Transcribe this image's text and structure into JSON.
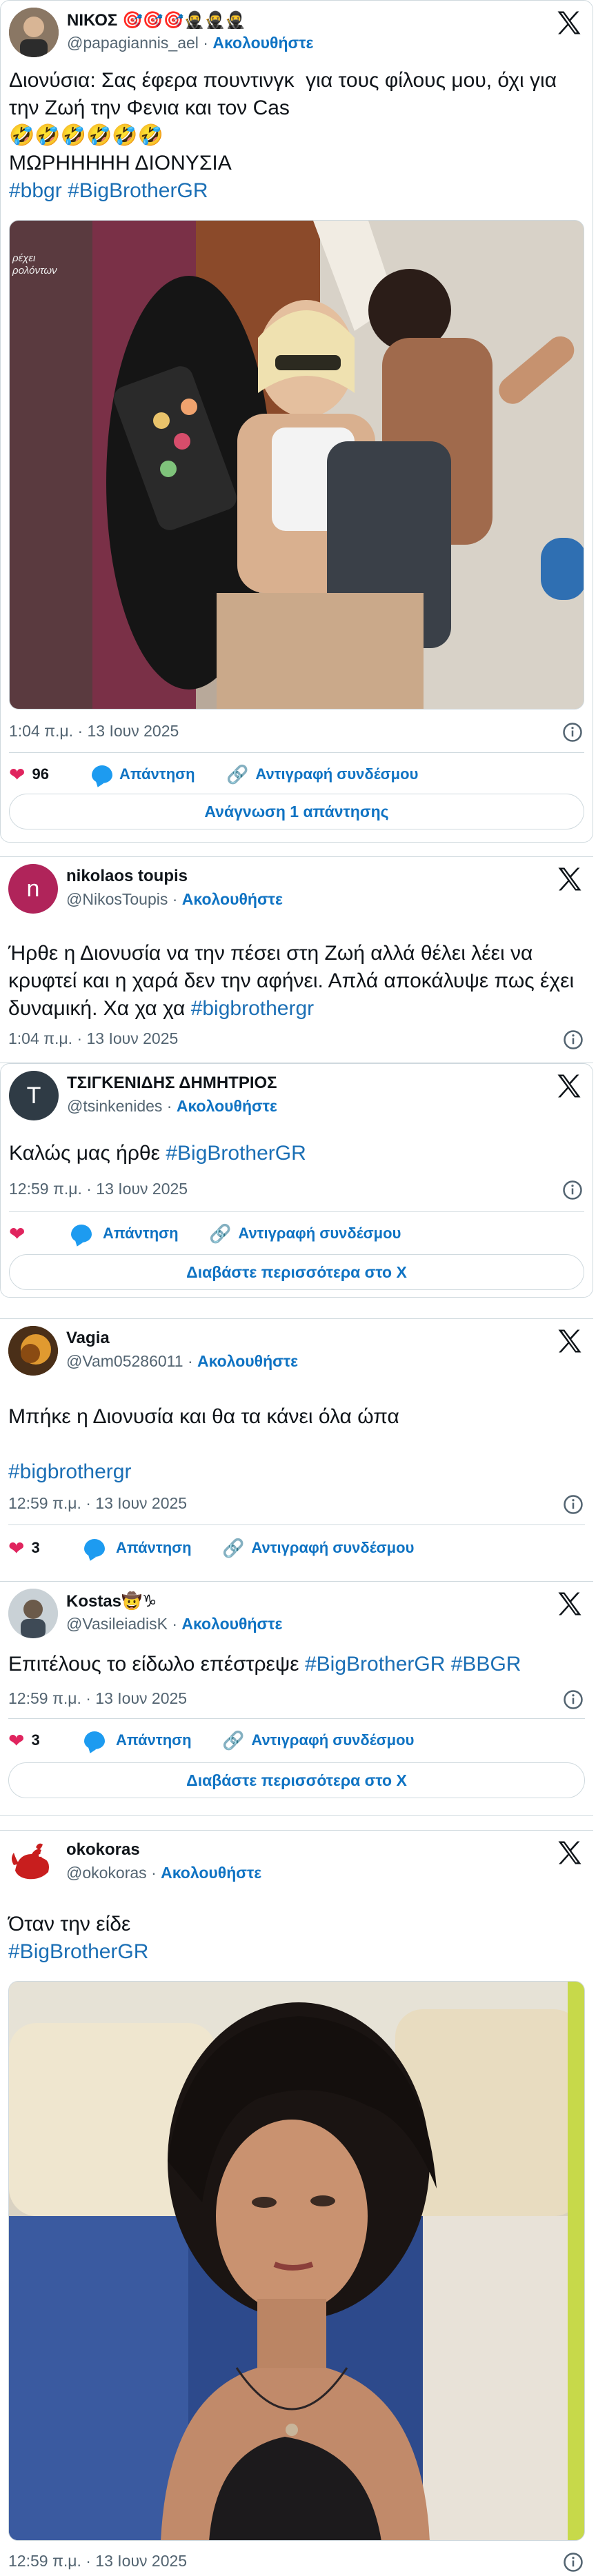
{
  "tweets": [
    {
      "name": "ΝΙΚΟΣ 🎯🎯🎯🥷🥷🥷",
      "handle": "@papagiannis_ael",
      "follow": "Ακολουθήστε",
      "text_plain": "Διονύσια: Σας έφερα πουντινγκ  για τους φίλους μου, όχι για την Ζωή την Φενια και τον Cas\n🤣🤣🤣🤣🤣🤣\nΜΩΡΗΗΗΗΗ ΔΙΟΝΥΣΙΑ\n",
      "hashtags": "#bbgr #BigBrotherGR",
      "overlay_text": "ρέχει\nρολόντων",
      "time": "1:04 π.μ. · 13 Ιουν 2025",
      "likes": "96",
      "reply": "Απάντηση",
      "copy": "Αντιγραφή συνδέσμου",
      "readmore": "Ανάγνωση 1 απάντησης"
    },
    {
      "name": "nikolaos toupis",
      "handle": "@NikosToupis",
      "follow": "Ακολουθήστε",
      "avatar_letter": "n",
      "text_plain": "Ήρθε η Διονυσία να την πέσει στη Ζωή αλλά θέλει λέει να κρυφτεί και η χαρά δεν την αφήνει. Απλά αποκάλυψε πως έχει δυναμική. Χα χα χα ",
      "hashtags": "#bigbrothergr",
      "time": "1:04 π.μ. · 13 Ιουν 2025"
    },
    {
      "name": "ΤΣΙΓΚΕΝΙΔΗΣ ΔΗΜΗΤΡΙΟΣ",
      "handle": "@tsinkenides",
      "follow": "Ακολουθήστε",
      "avatar_letter": "T",
      "text_plain": "Καλώς μας ήρθε ",
      "hashtags": "#BigBrotherGR",
      "time": "12:59 π.μ. · 13 Ιουν 2025",
      "reply": "Απάντηση",
      "copy": "Αντιγραφή συνδέσμου",
      "readmore": "Διαβάστε περισσότερα στο X"
    },
    {
      "name": "Vagia",
      "handle": "@Vam05286011",
      "follow": "Ακολουθήστε",
      "text_plain": "Μπήκε η Διονυσία και θα τα κάνει όλα ώπα\n\n",
      "hashtags": "#bigbrothergr",
      "time": "12:59 π.μ. · 13 Ιουν 2025",
      "likes": "3",
      "reply": "Απάντηση",
      "copy": "Αντιγραφή συνδέσμου"
    },
    {
      "name": "Kostas🤠♑",
      "handle": "@VasileiadisK",
      "follow": "Ακολουθήστε",
      "text_plain": "Επιτέλους το είδωλο επέστρεψε ",
      "hashtags": "#BigBrotherGR #BBGR",
      "time": "12:59 π.μ. · 13 Ιουν 2025",
      "likes": "3",
      "reply": "Απάντηση",
      "copy": "Αντιγραφή συνδέσμου",
      "readmore": "Διαβάστε περισσότερα στο X"
    },
    {
      "name": "okokoras",
      "handle": "@okokoras",
      "follow": "Ακολουθήστε",
      "text_plain": "Όταν την είδε\n",
      "hashtags": "#BigBrotherGR",
      "time": "12:59 π.μ. · 13 Ιουν 2025"
    }
  ],
  "colors": {
    "link": "#0f73c3",
    "hashtag": "#1b6fb5",
    "like": "#e0245e",
    "reply": "#1d9bf0",
    "border": "#cfd9de",
    "muted": "#536471"
  }
}
